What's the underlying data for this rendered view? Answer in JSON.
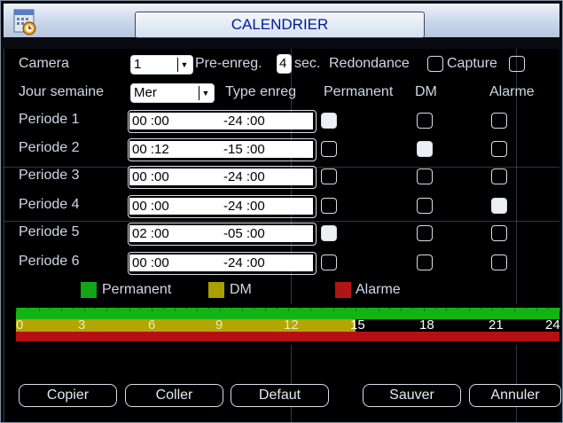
{
  "window": {
    "title": "CALENDRIER",
    "icon": "calendar-clock-icon"
  },
  "camera": {
    "label": "Camera",
    "value": "1"
  },
  "prerecord": {
    "label": "Pre-enreg.",
    "value": "4",
    "unit": "sec."
  },
  "redundancy": {
    "label": "Redondance",
    "checked": false
  },
  "capture": {
    "label": "Capture",
    "checked": false
  },
  "weekday": {
    "label": "Jour semaine",
    "value": "Mer"
  },
  "columns": {
    "type": "Type enreg",
    "permanent": "Permanent",
    "dm": "DM",
    "alarm": "Alarme"
  },
  "periods": [
    {
      "label": "Periode 1",
      "start": "00 :00",
      "end": "-24 :00",
      "permanent": true,
      "dm": false,
      "alarm": false
    },
    {
      "label": "Periode 2",
      "start": "00 :12",
      "end": "-15 :00",
      "permanent": false,
      "dm": true,
      "alarm": false
    },
    {
      "label": "Periode 3",
      "start": "00 :00",
      "end": "-24 :00",
      "permanent": false,
      "dm": false,
      "alarm": false
    },
    {
      "label": "Periode 4",
      "start": "00 :00",
      "end": "-24 :00",
      "permanent": false,
      "dm": false,
      "alarm": true
    },
    {
      "label": "Periode 5",
      "start": "02 :00",
      "end": "-05 :00",
      "permanent": true,
      "dm": false,
      "alarm": false
    },
    {
      "label": "Periode 6",
      "start": "00 :00",
      "end": "-24 :00",
      "permanent": false,
      "dm": false,
      "alarm": false
    }
  ],
  "legend": [
    {
      "label": "Permanent",
      "color": "#13a513"
    },
    {
      "label": "DM",
      "color": "#a8a000"
    },
    {
      "label": "Alarme",
      "color": "#b01515"
    }
  ],
  "timeline": {
    "hours": [
      "0",
      "3",
      "6",
      "9",
      "12",
      "15",
      "18",
      "21",
      "24"
    ],
    "bars": [
      {
        "name": "permanent",
        "color": "#13b313",
        "from_hour": 0,
        "to_hour": 24
      },
      {
        "name": "dm",
        "color": "#b4a500",
        "from_hour": 0,
        "to_hour": 15
      },
      {
        "name": "alarm",
        "color": "#b51010",
        "from_hour": 0,
        "to_hour": 24
      }
    ]
  },
  "buttons": {
    "copy": "Copier",
    "paste": "Coller",
    "default": "Defaut",
    "save": "Sauver",
    "cancel": "Annuler"
  }
}
